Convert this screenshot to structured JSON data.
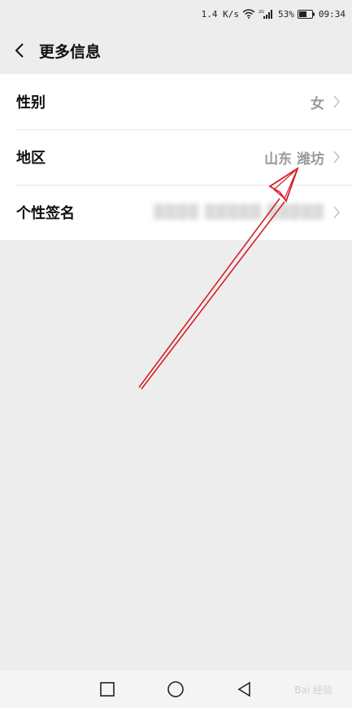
{
  "status_bar": {
    "speed": "1.4 K/s",
    "network": "2G",
    "battery": "53%",
    "time": "09:34"
  },
  "header": {
    "title": "更多信息"
  },
  "rows": [
    {
      "label": "性别",
      "value": "女"
    },
    {
      "label": "地区",
      "value": "山东 潍坊"
    },
    {
      "label": "个性签名",
      "value": "▒▒▒▒ ▒▒▒▒▒ ▒▒▒▒▒"
    }
  ],
  "watermark": "Bai 经验",
  "colors": {
    "background": "#ededed",
    "row_background": "#ffffff",
    "value_text": "#9a9a9a",
    "arrow": "#d42026"
  },
  "icons": {
    "back": "back-icon",
    "chevron": "chevron-right-icon",
    "nav_recent": "square-icon",
    "nav_home": "circle-icon",
    "nav_back": "triangle-back-icon"
  }
}
